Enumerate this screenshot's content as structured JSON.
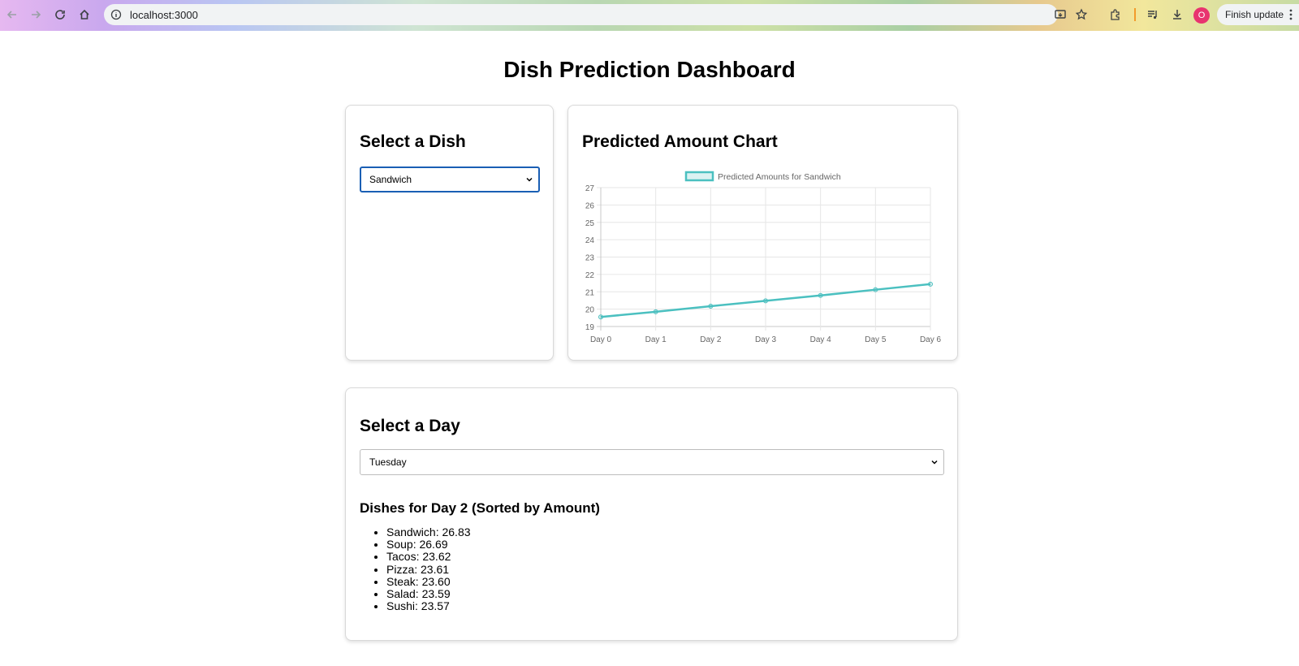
{
  "browser": {
    "url": "localhost:3000",
    "profile_initial": "O",
    "update_label": "Finish update"
  },
  "page": {
    "title": "Dish Prediction Dashboard"
  },
  "dish_panel": {
    "heading": "Select a Dish",
    "selected": "Sandwich"
  },
  "chart_panel": {
    "heading": "Predicted Amount Chart"
  },
  "chart_data": {
    "type": "line",
    "x": [
      "Day 0",
      "Day 1",
      "Day 2",
      "Day 3",
      "Day 4",
      "Day 5",
      "Day 6"
    ],
    "series": [
      {
        "name": "Predicted Amounts for Sandwich",
        "values": [
          19.55,
          19.85,
          20.17,
          20.48,
          20.79,
          21.12,
          21.44
        ]
      }
    ],
    "ylim": [
      19,
      27
    ],
    "yticks": [
      19,
      20,
      21,
      22,
      23,
      24,
      25,
      26,
      27
    ],
    "grid": true,
    "legend": "top",
    "color": "#4bc0c0"
  },
  "day_panel": {
    "heading": "Select a Day",
    "selected": "Tuesday",
    "list_title": "Dishes for Day 2 (Sorted by Amount)",
    "items": [
      "Sandwich: 26.83",
      "Soup: 26.69",
      "Tacos: 23.62",
      "Pizza: 23.61",
      "Steak: 23.60",
      "Salad: 23.59",
      "Sushi: 23.57"
    ]
  }
}
